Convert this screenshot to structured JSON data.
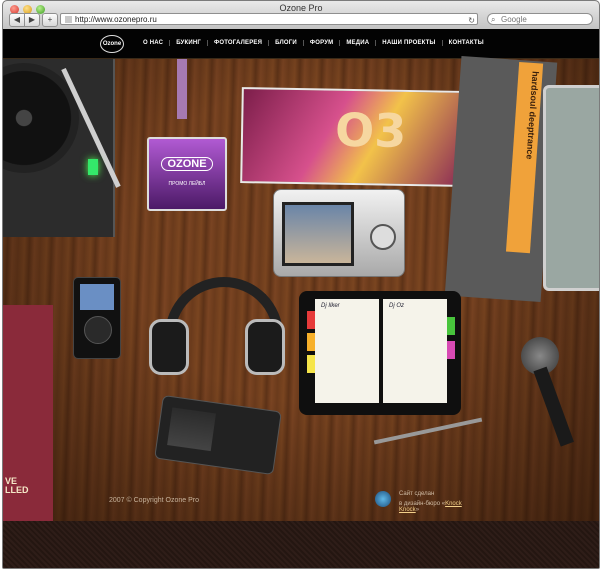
{
  "window": {
    "title": "Ozone Pro"
  },
  "toolbar": {
    "back": "◀",
    "forward": "▶",
    "add": "+",
    "reload": "↻"
  },
  "address": {
    "url": "http://www.ozonepro.ru"
  },
  "search": {
    "placeholder": "Google"
  },
  "site": {
    "logo": "Ozone",
    "menu": [
      "О НАС",
      "БУКИНГ",
      "ФОТОГАЛЕРЕЯ",
      "БЛОГИ",
      "ФОРУМ",
      "МЕДИА",
      "НАШИ ПРОЕКТЫ",
      "КОНТАКТЫ"
    ]
  },
  "badge": {
    "brand": "OZONE",
    "label": "ПРОМО ЛЕЙБЛ"
  },
  "book": {
    "spine": "hardsoul deeptrance"
  },
  "planner": {
    "left_label": "Dj Ilker",
    "right_label": "Dj Oz"
  },
  "leftbook": {
    "line1": "VE",
    "line2": "LLED"
  },
  "footer": {
    "copyright": "2007 © Copyright Ozone Pro",
    "made_by": "Сайт сделан",
    "studio_prefix": "в дизайн-бюро «",
    "studio_name": "Knock Knock",
    "studio_suffix": "»"
  }
}
